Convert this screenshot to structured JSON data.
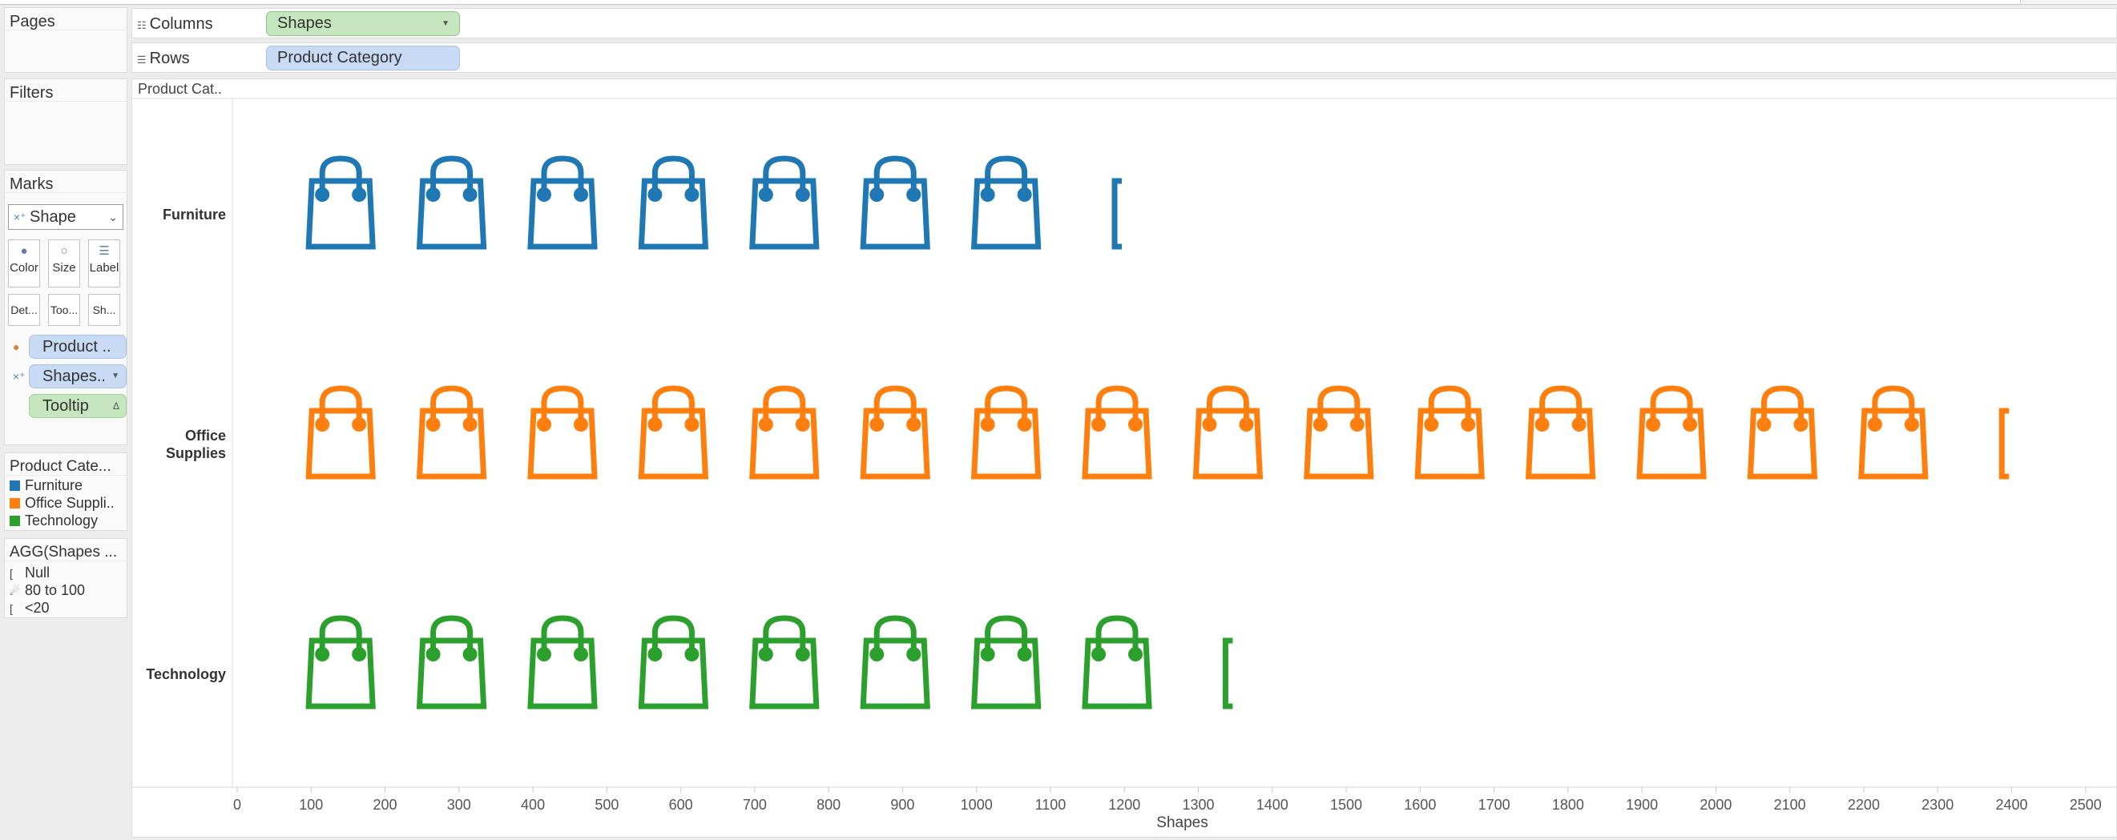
{
  "pages": {
    "title": "Pages"
  },
  "filters": {
    "title": "Filters"
  },
  "marks": {
    "title": "Marks",
    "type": "Shape",
    "buttons": [
      "Color",
      "Size",
      "Label",
      "Det...",
      "Too...",
      "Sh..."
    ],
    "fields": [
      "Product ..",
      "Shapes..",
      "Tooltip"
    ]
  },
  "columns_shelf": {
    "label": "Columns",
    "pill": "Shapes"
  },
  "rows_shelf": {
    "label": "Rows",
    "pill": "Product Category"
  },
  "legend_category": {
    "title": "Product Cate...",
    "items": [
      {
        "label": "Furniture",
        "color": "#1f77b4"
      },
      {
        "label": "Office Suppli..",
        "color": "#ff7f0e"
      },
      {
        "label": "Technology",
        "color": "#2ca02c"
      }
    ]
  },
  "legend_shape": {
    "title": "AGG(Shapes ...",
    "items": [
      {
        "label": "Null",
        "icon": "bracket-icon"
      },
      {
        "label": "80 to 100",
        "icon": "shopping-bag-icon"
      },
      {
        "label": "<20",
        "icon": "bracket-icon"
      }
    ]
  },
  "view": {
    "header_label": "Product Cat.."
  },
  "chart_data": {
    "type": "scatter",
    "xlabel": "Shapes",
    "ylabel": "",
    "xlim": [
      0,
      2580
    ],
    "xticks": [
      0,
      100,
      200,
      300,
      400,
      500,
      600,
      700,
      800,
      900,
      1000,
      1100,
      1200,
      1300,
      1400,
      1500,
      1600,
      1700,
      1800,
      1900,
      2000,
      2100,
      2200,
      2300,
      2400,
      2500
    ],
    "categories": [
      "Furniture",
      "Office Supplies",
      "Technology"
    ],
    "category_labels": [
      [
        "Furniture"
      ],
      [
        "Office",
        "Supplies"
      ],
      [
        "Technology"
      ]
    ],
    "series": [
      {
        "name": "Furniture",
        "color": "#1f77b4",
        "bag_x": [
          140,
          290,
          440,
          590,
          740,
          890,
          1040
        ],
        "bracket_x": [
          1190
        ]
      },
      {
        "name": "Office Supplies",
        "color": "#ff7f0e",
        "bag_x": [
          140,
          290,
          440,
          590,
          740,
          890,
          1040,
          1190,
          1340,
          1490,
          1640,
          1790,
          1940,
          2090,
          2240
        ],
        "bracket_x": [
          2390
        ]
      },
      {
        "name": "Technology",
        "color": "#2ca02c",
        "bag_x": [
          140,
          290,
          440,
          590,
          740,
          890,
          1040,
          1190
        ],
        "bracket_x": [
          1340
        ]
      }
    ]
  }
}
